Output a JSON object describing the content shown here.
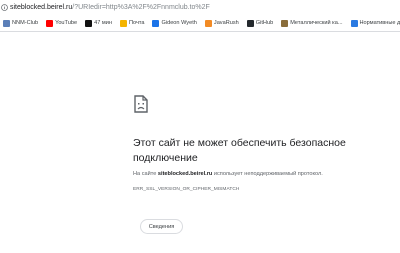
{
  "address_bar": {
    "url_host": "siteblocked.beirel.ru",
    "url_rest": "/?URIedir=http%3A%2F%2Fnnmclub.to%2F"
  },
  "bookmarks": [
    {
      "label": "NNM-Club",
      "icon": "nnm-icon",
      "color": "#5b7fb8"
    },
    {
      "label": "YouTube",
      "icon": "youtube-icon",
      "color": "#ff0000"
    },
    {
      "label": "47 мин",
      "icon": "clock-icon",
      "color": "#111111"
    },
    {
      "label": "Почта",
      "icon": "mail-icon",
      "color": "#f4b400"
    },
    {
      "label": "Gideon Wyeth",
      "icon": "profile-icon",
      "color": "#1a73e8"
    },
    {
      "label": "JavaRush",
      "icon": "javarush-icon",
      "color": "#f28b25"
    },
    {
      "label": "GitHub",
      "icon": "github-icon",
      "color": "#24292e"
    },
    {
      "label": "Металлический ка...",
      "icon": "bookmark-icon",
      "color": "#8a6d3b"
    },
    {
      "label": "Нормативные докр...",
      "icon": "globe-icon",
      "color": "#2a7ae2"
    }
  ],
  "error": {
    "title": "Этот сайт не может обеспечить безопасное подключение",
    "host": "siteblocked.beirel.ru",
    "description_suffix": " использует неподдерживаемый протокол.",
    "description_prefix": "На сайте ",
    "code": "ERR_SSL_VERSION_OR_CIPHER_MISMATCH",
    "details_button": "Сведения"
  }
}
